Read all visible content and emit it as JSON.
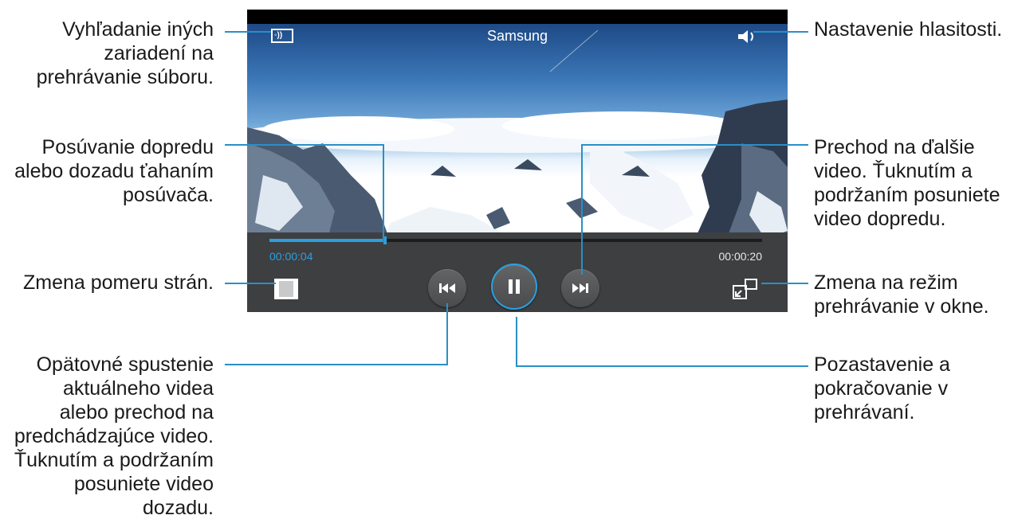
{
  "player": {
    "title": "Samsung",
    "current_time": "00:00:04",
    "total_time": "00:00:20",
    "progress_fraction": 0.235,
    "accent_color": "#2aa0e0",
    "icons": {
      "cast": "screen-mirroring-icon",
      "volume": "speaker-icon",
      "aspect": "aspect-ratio-icon",
      "prev": "previous-track-icon",
      "pause": "pause-icon",
      "next": "next-track-icon",
      "popup": "popup-window-icon"
    }
  },
  "annotations": {
    "search_devices": "Vyhľadanie iných\nzariadení na\nprehrávanie súboru.",
    "seek": "Posúvanie dopredu\nalebo dozadu ťahaním\nposúvača.",
    "aspect_ratio": "Zmena pomeru strán.",
    "previous": "Opätovné spustenie\naktuálneho videa\nalebo prechod na\npredchádzajúce video.\nŤuknutím a podržaním\nposuniete video\ndozadu.",
    "volume": "Nastavenie hlasitosti.",
    "next": "Prechod na ďalšie\nvideo. Ťuknutím a\npodržaním posuniete\nvideo dopredu.",
    "popup_mode": "Zmena na režim\nprehrávanie v okne.",
    "pause": "Pozastavenie a\npokračovanie v\nprehrávaní."
  }
}
